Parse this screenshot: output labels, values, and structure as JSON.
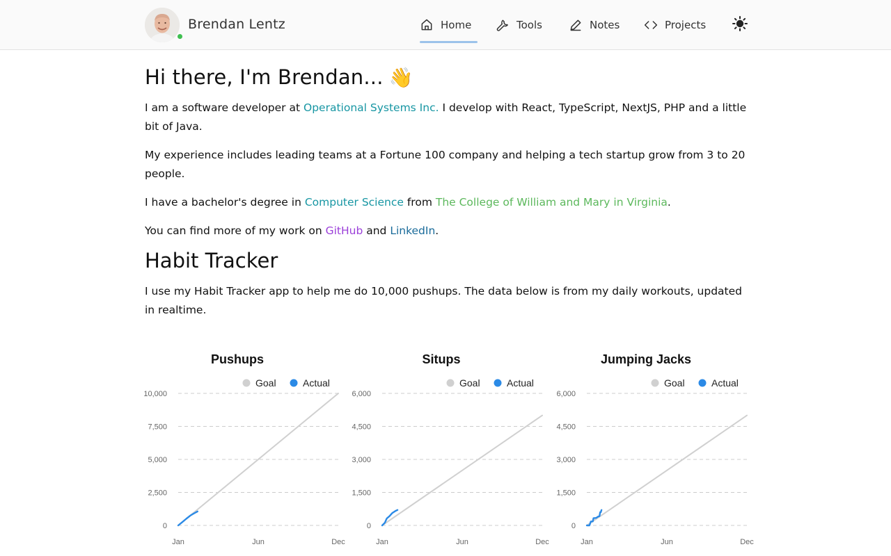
{
  "header": {
    "name": "Brendan Lentz",
    "nav": [
      {
        "label": "Home",
        "icon": "home-icon",
        "active": true
      },
      {
        "label": "Tools",
        "icon": "wrench-icon"
      },
      {
        "label": "Notes",
        "icon": "pencil-icon"
      },
      {
        "label": "Projects",
        "icon": "code-icon"
      }
    ],
    "theme_toggle_icon": "sun-icon"
  },
  "intro": {
    "heading": "Hi there, I'm Brendan...",
    "wave_emoji": "👋",
    "p1": {
      "before": "I am a software developer at ",
      "link": "Operational Systems Inc.",
      "after": " I develop with React, TypeScript, NextJS, PHP and a little bit of Java."
    },
    "p2": "My experience includes leading teams at a Fortune 100 company and helping a tech startup grow from 3 to 20 people.",
    "p3": {
      "before": "I have a bachelor's degree in ",
      "link1": "Computer Science",
      "middle": " from ",
      "link2": "The College of William and Mary in Virginia",
      "after": "."
    },
    "p4": {
      "before": "You can find more of my work on ",
      "link1": "GitHub",
      "middle": " and ",
      "link2": "LinkedIn",
      "after": "."
    }
  },
  "habit": {
    "heading": "Habit Tracker",
    "description": "I use my Habit Tracker app to help me do 10,000 pushups. The data below is from my daily workouts, updated in realtime."
  },
  "colors": {
    "goal": "#d0d0d0",
    "actual": "#2b8ae6",
    "grid": "#cccccc",
    "avatar_status": "#3fbf50"
  },
  "chart_data": [
    {
      "type": "line",
      "title": "Pushups",
      "legend": [
        "Goal",
        "Actual"
      ],
      "legend_position": "top-right",
      "x_ticks": [
        "Jan",
        "Jun",
        "Dec"
      ],
      "y_ticks": [
        "0",
        "2,500",
        "5,000",
        "7,500",
        "10,000"
      ],
      "ylim": [
        0,
        10000
      ],
      "grid": "horizontal dashed",
      "series": [
        {
          "name": "Goal",
          "points": [
            [
              0,
              0
            ],
            [
              12,
              10000
            ]
          ]
        },
        {
          "name": "Actual",
          "points": [
            [
              0,
              0
            ],
            [
              0.3,
              250
            ],
            [
              0.6,
              500
            ],
            [
              0.9,
              740
            ],
            [
              1.2,
              920
            ],
            [
              1.45,
              1060
            ]
          ]
        }
      ]
    },
    {
      "type": "line",
      "title": "Situps",
      "legend": [
        "Goal",
        "Actual"
      ],
      "legend_position": "top-right",
      "x_ticks": [
        "Jan",
        "Jun",
        "Dec"
      ],
      "y_ticks": [
        "0",
        "1,500",
        "3,000",
        "4,500",
        "6,000"
      ],
      "ylim": [
        0,
        6000
      ],
      "grid": "horizontal dashed",
      "series": [
        {
          "name": "Goal",
          "points": [
            [
              0,
              0
            ],
            [
              12,
              5000
            ]
          ]
        },
        {
          "name": "Actual",
          "points": [
            [
              0,
              0
            ],
            [
              0.2,
              120
            ],
            [
              0.35,
              320
            ],
            [
              0.55,
              420
            ],
            [
              0.75,
              560
            ],
            [
              1.0,
              660
            ],
            [
              1.15,
              700
            ]
          ]
        }
      ]
    },
    {
      "type": "line",
      "title": "Jumping Jacks",
      "legend": [
        "Goal",
        "Actual"
      ],
      "legend_position": "top-right",
      "x_ticks": [
        "Jan",
        "Jun",
        "Dec"
      ],
      "y_ticks": [
        "0",
        "1,500",
        "3,000",
        "4,500",
        "6,000"
      ],
      "ylim": [
        0,
        6000
      ],
      "grid": "horizontal dashed",
      "series": [
        {
          "name": "Goal",
          "points": [
            [
              0,
              0
            ],
            [
              12,
              5000
            ]
          ]
        },
        {
          "name": "Actual",
          "points": [
            [
              0,
              0
            ],
            [
              0.2,
              0
            ],
            [
              0.3,
              180
            ],
            [
              0.45,
              180
            ],
            [
              0.5,
              330
            ],
            [
              0.7,
              340
            ],
            [
              0.85,
              400
            ],
            [
              0.95,
              420
            ],
            [
              1.0,
              600
            ],
            [
              1.05,
              600
            ],
            [
              1.1,
              700
            ]
          ]
        }
      ]
    }
  ]
}
